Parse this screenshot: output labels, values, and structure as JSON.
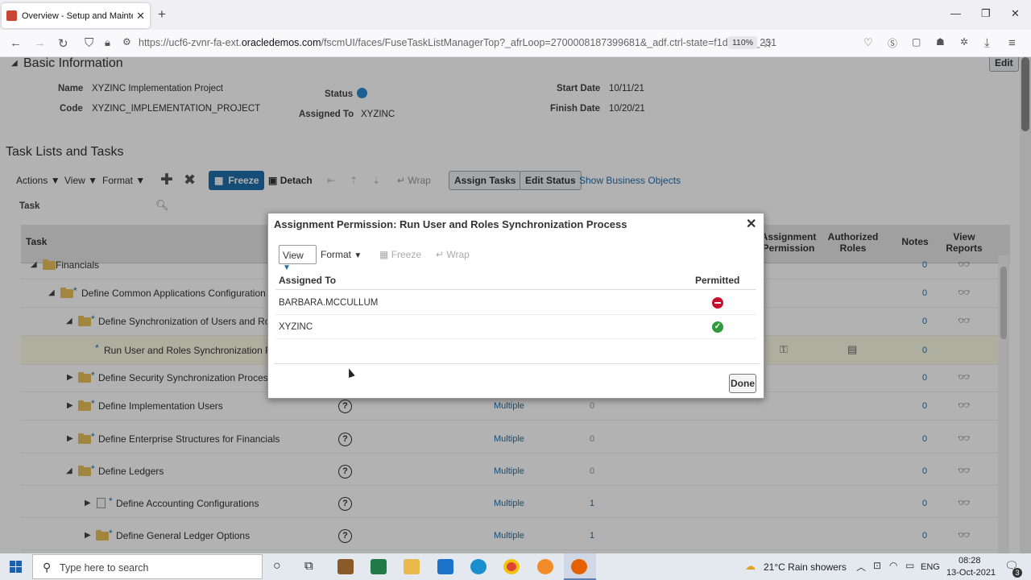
{
  "browser": {
    "tab_title": "Overview - Setup and Maintena",
    "url_prefix": "https://ucf6-zvnr-fa-ext.",
    "url_domain": "oracledemos.com",
    "url_rest": "/fscmUI/faces/FuseTaskListManagerTop?_afrLoop=2700008187399681&_adf.ctrl-state=f1d9liy9q_231",
    "zoom": "110%"
  },
  "basic": {
    "title": "Basic Information",
    "edit": "Edit",
    "name_label": "Name",
    "name_value": "XYZINC Implementation Project",
    "code_label": "Code",
    "code_value": "XYZINC_IMPLEMENTATION_PROJECT",
    "status_label": "Status",
    "assigned_label": "Assigned To",
    "assigned_value": "XYZINC",
    "start_label": "Start Date",
    "start_value": "10/11/21",
    "finish_label": "Finish Date",
    "finish_value": "10/20/21"
  },
  "tasks": {
    "title": "Task Lists and Tasks",
    "toolbar": {
      "actions": "Actions",
      "view": "View",
      "format": "Format",
      "freeze": "Freeze",
      "detach": "Detach",
      "wrap": "Wrap",
      "assign": "Assign Tasks",
      "edit_status": "Edit Status",
      "show_bo": "Show Business Objects"
    },
    "filter_label": "Task",
    "columns": {
      "task": "Task",
      "assignment1": "Assignment",
      "assignment2": "Permission",
      "authorized1": "Authorized",
      "authorized2": "Roles",
      "notes": "Notes",
      "view1": "View",
      "view2": "Reports"
    },
    "rows": [
      {
        "label": "Financials",
        "notes": "0"
      },
      {
        "label": "Define Common Applications Configuration for F",
        "notes": "0"
      },
      {
        "label": "Define Synchronization of Users and Roles",
        "notes": "0"
      },
      {
        "label": "Run User and Roles Synchronization Proc",
        "notes": "0"
      },
      {
        "label": "Define Security Synchronization Processes",
        "notes": "0"
      },
      {
        "label": "Define Implementation Users",
        "assigned": "Multiple",
        "count": "0",
        "notes": "0"
      },
      {
        "label": "Define Enterprise Structures for Financials",
        "assigned": "Multiple",
        "count": "0",
        "notes": "0"
      },
      {
        "label": "Define Ledgers",
        "assigned": "Multiple",
        "count": "0",
        "notes": "0"
      },
      {
        "label": "Define Accounting Configurations",
        "assigned": "Multiple",
        "count": "1",
        "notes": "0"
      },
      {
        "label": "Define General Ledger Options",
        "assigned": "Multiple",
        "count": "1",
        "notes": "0"
      }
    ]
  },
  "dialog": {
    "title": "Assignment Permission: Run User and Roles Synchronization Process",
    "view": "View",
    "format": "Format",
    "freeze": "Freeze",
    "wrap": "Wrap",
    "col_assigned": "Assigned To",
    "col_permitted": "Permitted",
    "rows": [
      {
        "name": "BARBARA.MCCULLUM",
        "permitted": false
      },
      {
        "name": "XYZINC",
        "permitted": true
      }
    ],
    "done": "Done"
  },
  "taskbar": {
    "search_placeholder": "Type here to search",
    "weather": "21°C  Rain showers",
    "lang": "ENG",
    "time": "08:28",
    "date": "13-Oct-2021",
    "notif_count": "3"
  }
}
